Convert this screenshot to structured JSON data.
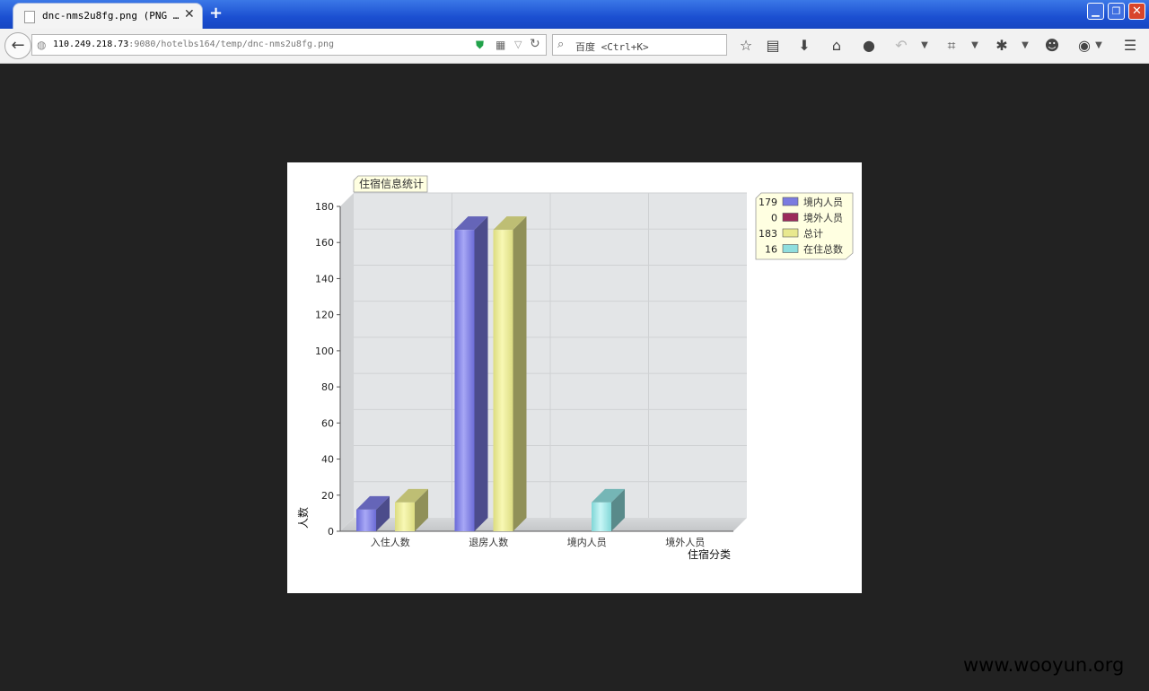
{
  "browser": {
    "tab_title": "dnc-nms2u8fg.png (PNG …",
    "tab_close": "✕",
    "new_tab": "+",
    "url_host": "110.249.218.73",
    "url_rest": ":9080/hotelbs164/temp/dnc-nms2u8fg.png",
    "search_placeholder": "百度 <Ctrl+K>",
    "window_buttons": {
      "minimize": "▁",
      "maximize": "❐",
      "close": "✕"
    },
    "icons": [
      "back-arrow-icon",
      "globe-icon",
      "shield-icon",
      "qr-code-icon",
      "dropdown-icon",
      "reload-icon",
      "search-icon",
      "star-icon",
      "reading-list-icon",
      "download-icon",
      "home-icon",
      "chat-icon",
      "undo-icon",
      "crop-icon",
      "bug-icon",
      "smiley-icon",
      "hat-icon",
      "menu-icon"
    ]
  },
  "watermark": "www.wooyun.org",
  "chart_data": {
    "type": "bar",
    "title": "住宿信息统计",
    "xlabel": "住宿分类",
    "ylabel": "人数",
    "categories": [
      "入住人数",
      "退房人数",
      "境内人员",
      "境外人员"
    ],
    "ylim": [
      0,
      180
    ],
    "yticks": [
      0,
      20,
      40,
      60,
      80,
      100,
      120,
      140,
      160,
      180
    ],
    "grid": true,
    "legend_position": "right",
    "series": [
      {
        "name": "境内人员",
        "color": "#7b7be0",
        "values": [
          12,
          167,
          0,
          0
        ]
      },
      {
        "name": "总计",
        "color": "#e8e88e",
        "values": [
          16,
          167,
          0,
          0
        ]
      },
      {
        "name": "在住总数",
        "color": "#8fdede",
        "values": [
          0,
          0,
          16,
          0
        ]
      }
    ],
    "legend": [
      {
        "value": "179",
        "name": "境内人员",
        "color": "#7b7be0"
      },
      {
        "value": "0",
        "name": "境外人员",
        "color": "#9b2a5a"
      },
      {
        "value": "183",
        "name": "总计",
        "color": "#e8e88e"
      },
      {
        "value": "16",
        "name": "在住总数",
        "color": "#8fdede"
      }
    ]
  }
}
